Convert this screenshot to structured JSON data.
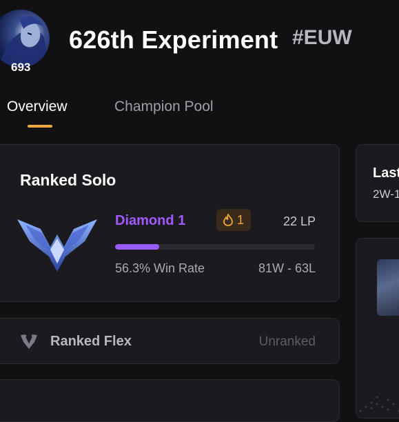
{
  "profile": {
    "name": "626th Experiment",
    "tag": "#EUW",
    "level": "693"
  },
  "tabs": [
    {
      "label": "Overview",
      "active": true
    },
    {
      "label": "Champion Pool",
      "active": false
    }
  ],
  "ranked_solo": {
    "title": "Ranked Solo",
    "rank": "Diamond 1",
    "streak": "1",
    "lp": "22 LP",
    "lp_progress": 0.22,
    "win_rate": "56.3% Win Rate",
    "record": "81W - 63L"
  },
  "ranked_flex": {
    "title": "Ranked Flex",
    "status": "Unranked"
  },
  "last_games": {
    "title": "Last",
    "record": "2W-1"
  },
  "colors": {
    "accent_tab": "#f1a83b",
    "rank_purple": "#a259ff",
    "streak_orange": "#f1a83b",
    "bg": "#111114",
    "card": "#1a1a1f"
  },
  "icons": {
    "streak": "flame-icon",
    "flex": "ranked-flex-crest-icon",
    "emblem": "diamond-emblem-icon"
  }
}
